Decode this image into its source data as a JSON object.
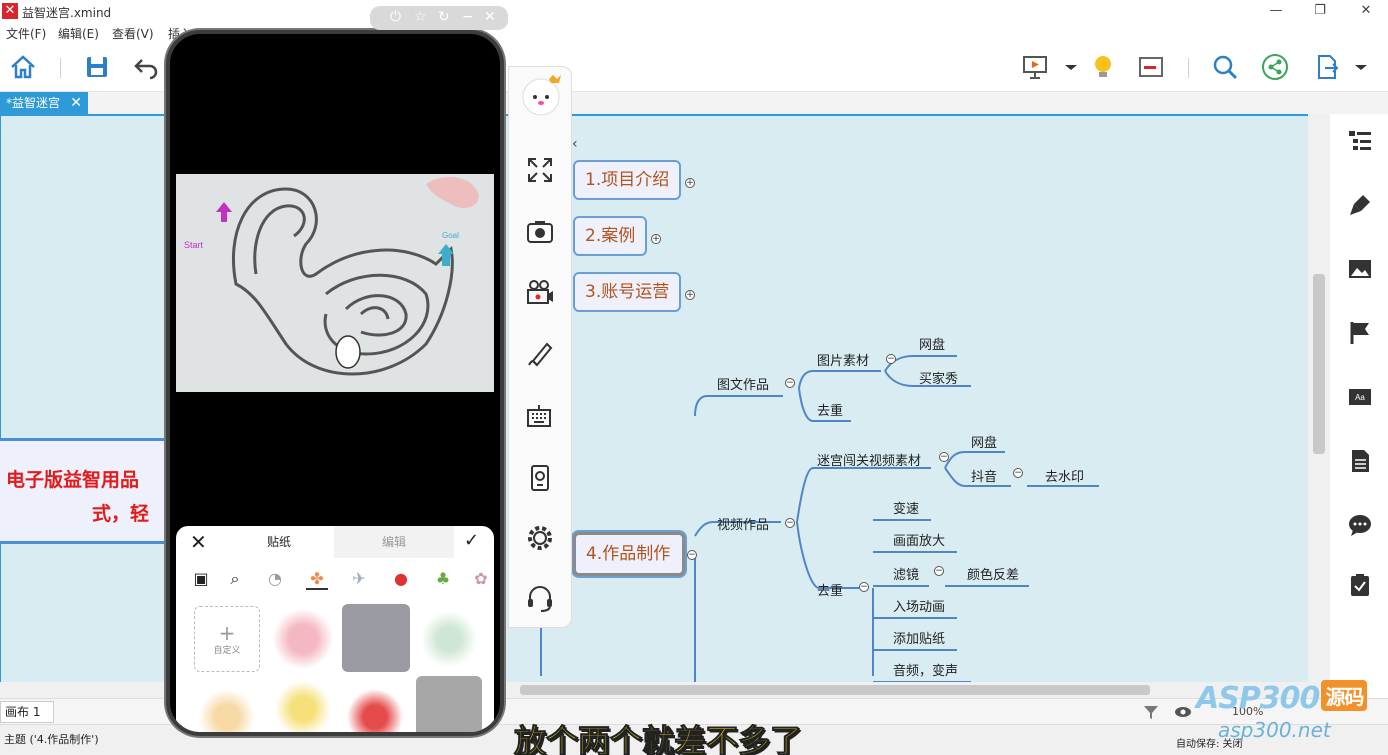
{
  "window": {
    "title": "益智迷宫.xmind",
    "minimize": "—",
    "maximize": "❐",
    "close": "✕"
  },
  "menu": [
    "文件(F)",
    "编辑(E)",
    "查看(V)",
    "插入"
  ],
  "tab": {
    "label": "*益智迷宫",
    "close": "✕"
  },
  "mindmap": {
    "topics": [
      {
        "label": "1.项目介绍",
        "expand": "+"
      },
      {
        "label": "2.案例",
        "expand": "+"
      },
      {
        "label": "3.账号运营",
        "expand": "+"
      },
      {
        "label": "4.作品制作",
        "expand": "−"
      }
    ],
    "branches": {
      "graphic_work": "图文作品",
      "picture_material": "图片素材",
      "netdisk_1": "网盘",
      "maijiaxiu": "买家秀",
      "dedup_1": "去重",
      "video_work": "视频作品",
      "maze_video_material": "迷宫闯关视频素材",
      "netdisk_2": "网盘",
      "douyin": "抖音",
      "remove_watermark": "去水印",
      "dedup_2": "去重",
      "speed": "变速",
      "zoom_in": "画面放大",
      "filter": "滤镜",
      "color_invert": "颜色反差",
      "intro_anim": "入场动画",
      "add_sticker": "添加贴纸",
      "audio": "音频，变声"
    },
    "collapse_sign": "−"
  },
  "banner": {
    "line1": "电子版益智用品",
    "line2": "式，轻"
  },
  "phone": {
    "maze_start": "Start",
    "maze_goal": "Goal",
    "sticker_panel": {
      "close": "✕",
      "tab_sticker": "贴纸",
      "tab_edit": "编辑",
      "confirm": "✓",
      "custom_label": "自定义",
      "custom_plus": "+"
    }
  },
  "sheet": {
    "tab_label": "画布 1"
  },
  "status": {
    "topic": "主题 ('4.作品制作')",
    "autosave": "自动保存: 关闭",
    "zoom": "100%"
  },
  "subtitle": "放个两个就差不多了",
  "watermark": {
    "brand": "ASP300",
    "badge": "源码",
    "url": "asp300.net"
  },
  "colors": {
    "accent": "#2e9ad8",
    "canvas_bg": "#d8ecf1",
    "topic_text": "#b2531d",
    "banner_text": "#e21b1b",
    "subtitle": "#ffe100"
  }
}
